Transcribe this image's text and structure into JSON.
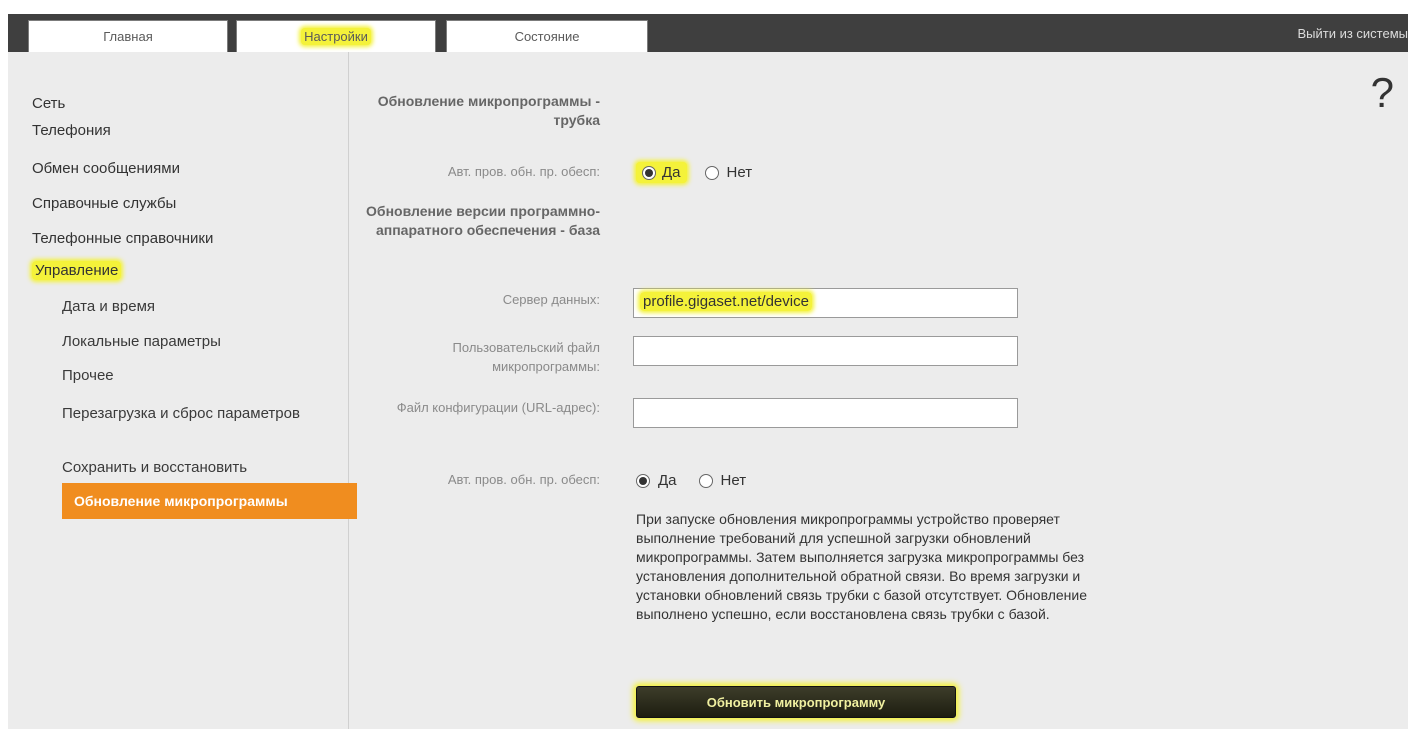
{
  "tabs": [
    {
      "label": "Главная"
    },
    {
      "label": "Настройки"
    },
    {
      "label": "Состояние"
    }
  ],
  "logout_label": "Выйти из системы",
  "help_symbol": "?",
  "sidebar": {
    "items": [
      {
        "label": "Сеть"
      },
      {
        "label": "Телефония"
      },
      {
        "label": "Обмен сообщениями"
      },
      {
        "label": "Справочные службы"
      },
      {
        "label": "Телефонные справочники"
      },
      {
        "label": "Управление"
      }
    ],
    "sub_items": [
      {
        "label": "Дата и время"
      },
      {
        "label": "Локальные параметры"
      },
      {
        "label": "Прочее"
      },
      {
        "label": "Перезагрузка и сброс параметров"
      },
      {
        "label": "Сохранить и восстановить"
      },
      {
        "label": "Обновление микропрограммы"
      }
    ]
  },
  "form": {
    "section_handset_title": "Обновление микропрограммы - трубка",
    "auto_check_label": "Авт. пров. обн. пр. обесп:",
    "radio_yes": "Да",
    "radio_no": "Нет",
    "section_base_title": "Обновление версии программно-аппаратного обеспечения - база",
    "data_server_label": "Сервер данных:",
    "data_server_value": "profile.gigaset.net/device",
    "user_firmware_label": "Пользовательский файл микропрограммы:",
    "user_firmware_value": "",
    "config_file_label": "Файл конфигурации (URL-адрес):",
    "config_file_value": "",
    "auto_check_label_2": "Авт. пров. обн. пр. обесп:",
    "info_text": "При запуске обновления микропрограммы устройство проверяет выполнение требований для успешной загрузки обновлений микропрограммы. Затем выполняется загрузка микропрограммы без установления дополнительной обратной связи. Во время загрузки и установки обновлений связь трубки с базой отсутствует. Обновление выполнено успешно, если восстановлена связь трубки с базой.",
    "update_button": "Обновить микропрограмму"
  },
  "colors": {
    "highlight": "#f4f23a",
    "active_nav": "#f08d1f",
    "topbar": "#3f3f3f"
  }
}
